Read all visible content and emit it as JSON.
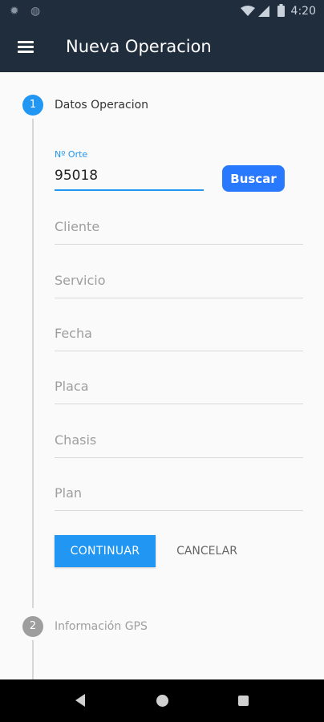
{
  "status_bar": {
    "time": "4:20",
    "left_icons": [
      "settings-icon",
      "circle-icon"
    ],
    "right_icons": [
      "wifi-icon",
      "signal-icon",
      "battery-icon"
    ]
  },
  "app_bar": {
    "title": "Nueva Operacion",
    "menu_icon": "menu-icon",
    "color": "#1f2d3d"
  },
  "stepper": {
    "active_color": "#2196f3",
    "inactive_color": "#9e9e9e",
    "steps": [
      {
        "number": "1",
        "title": "Datos Operacion",
        "state": "active"
      },
      {
        "number": "2",
        "title": "Información GPS",
        "state": "inactive"
      }
    ]
  },
  "form": {
    "orte_label": "Nº Orte",
    "orte_value": "95018",
    "search_label": "Buscar",
    "fields": [
      {
        "placeholder": "Cliente"
      },
      {
        "placeholder": "Servicio"
      },
      {
        "placeholder": "Fecha"
      },
      {
        "placeholder": "Placa"
      },
      {
        "placeholder": "Chasis"
      },
      {
        "placeholder": "Plan"
      }
    ],
    "continue_label": "CONTINUAR",
    "cancel_label": "CANCELAR"
  },
  "nav_bar": {
    "buttons": [
      "back-icon",
      "home-icon",
      "recent-apps-icon"
    ]
  }
}
